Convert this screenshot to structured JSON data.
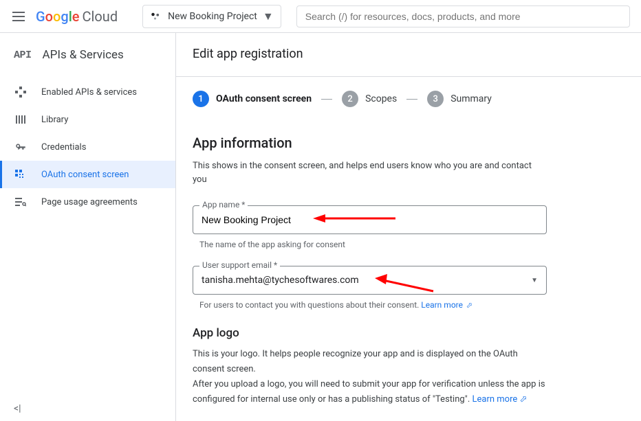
{
  "header": {
    "logo_cloud": "Cloud",
    "project_name": "New Booking Project",
    "search_placeholder": "Search (/) for resources, docs, products, and more"
  },
  "sidebar": {
    "title": "APIs & Services",
    "api_icon": "API",
    "items": [
      {
        "label": "Enabled APIs & services"
      },
      {
        "label": "Library"
      },
      {
        "label": "Credentials"
      },
      {
        "label": "OAuth consent screen"
      },
      {
        "label": "Page usage agreements"
      }
    ]
  },
  "main": {
    "page_title": "Edit app registration",
    "steps": [
      {
        "num": "1",
        "label": "OAuth consent screen"
      },
      {
        "num": "2",
        "label": "Scopes"
      },
      {
        "num": "3",
        "label": "Summary"
      }
    ],
    "app_info": {
      "title": "App information",
      "desc": "This shows in the consent screen, and helps end users know who you are and contact you",
      "app_name_label": "App name *",
      "app_name_value": "New Booking Project",
      "app_name_helper": "The name of the app asking for consent",
      "email_label": "User support email *",
      "email_value": "tanisha.mehta@tychesoftwares.com",
      "email_helper_prefix": "For users to contact you with questions about their consent. ",
      "learn_more": "Learn more"
    },
    "app_logo": {
      "title": "App logo",
      "desc_prefix": "This is your logo. It helps people recognize your app and is displayed on the OAuth consent screen.\nAfter you upload a logo, you will need to submit your app for verification unless the app is configured for internal use only or has a publishing status of \"Testing\". ",
      "learn_more": "Learn more"
    }
  }
}
